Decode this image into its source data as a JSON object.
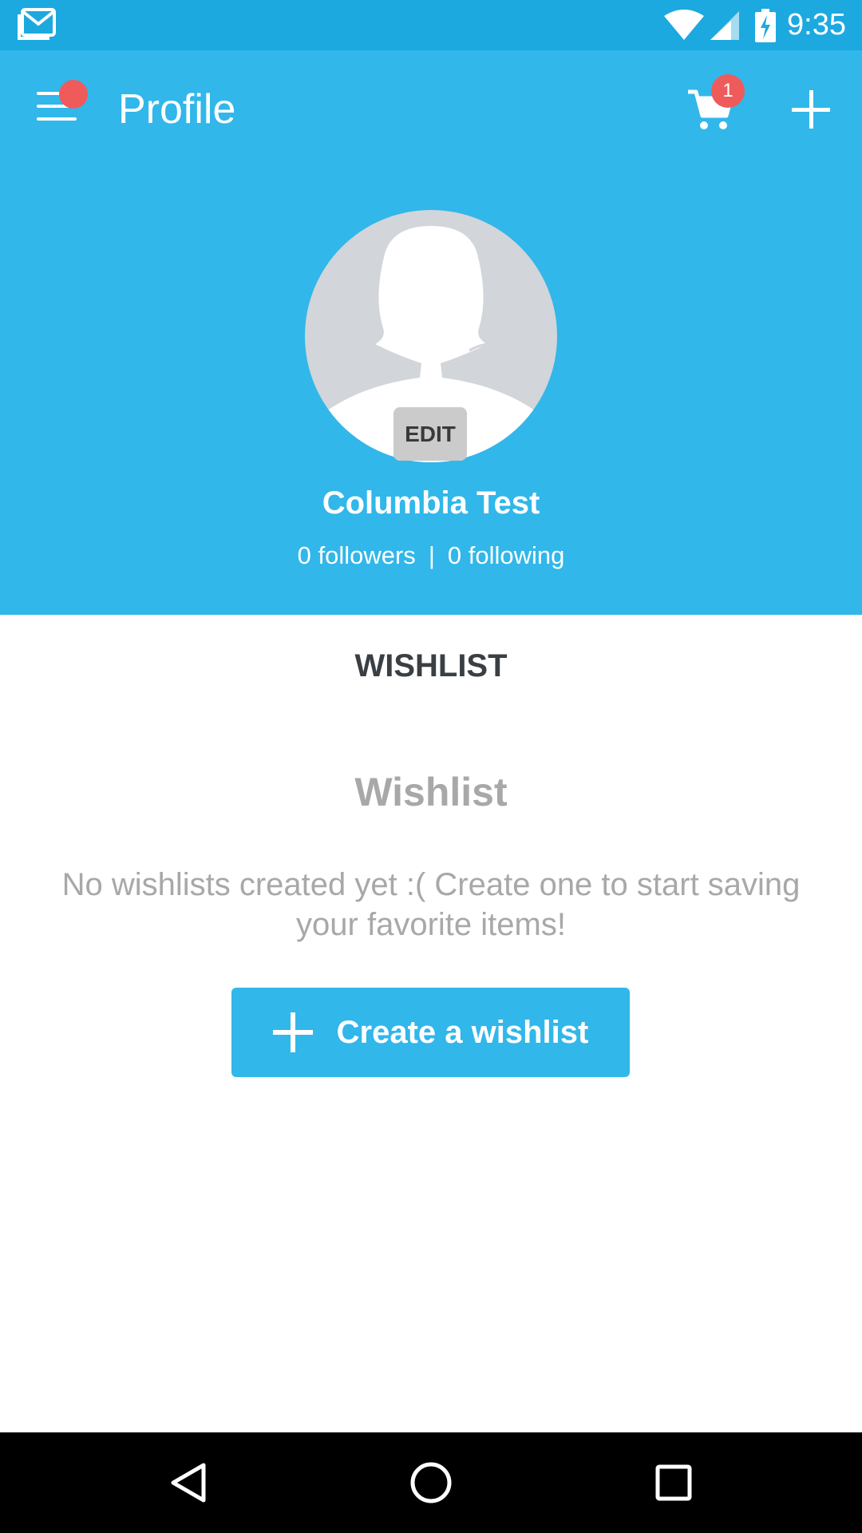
{
  "status_bar": {
    "time": "9:35",
    "icons": [
      "gmail-icon",
      "wifi-icon",
      "signal-icon",
      "battery-charging-icon"
    ],
    "color": "#1ca9df"
  },
  "app_bar": {
    "title": "Profile",
    "menu_icon": "hamburger-menu-icon",
    "cart_icon": "shopping-cart-icon",
    "cart_badge_count": "1",
    "add_icon": "plus-icon",
    "color": "#31b7ea",
    "badge_color": "#ef5b5b"
  },
  "profile": {
    "avatar_icon": "default-avatar-silhouette-icon",
    "edit_label": "EDIT",
    "name": "Columbia Test",
    "followers": "0 followers",
    "separator": "|",
    "following": "0 following"
  },
  "content": {
    "tab_title": "WISHLIST",
    "empty_title": "Wishlist",
    "empty_message": "No wishlists created yet :( Create one to start saving your favorite items!",
    "create_button_label": "Create a wishlist",
    "create_button_icon": "plus-icon"
  },
  "nav_bar": {
    "back_icon": "back-triangle-icon",
    "home_icon": "home-circle-icon",
    "recents_icon": "recents-square-icon"
  }
}
